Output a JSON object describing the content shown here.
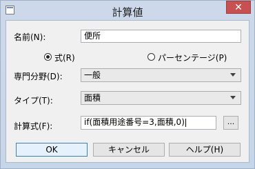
{
  "window": {
    "title": "計算値",
    "close_glyph": "✕"
  },
  "form": {
    "name_label": "名前(N):",
    "name_value": "便所",
    "radio_formula_label": "式(R)",
    "radio_percent_label": "パーセンテージ(P)",
    "category_label": "専門分野(D):",
    "category_value": "一般",
    "type_label": "タイプ(T):",
    "type_value": "面積",
    "formula_label": "計算式(F):",
    "formula_value": "if(面積用途番号=3,面積,0)",
    "browse_label": "..."
  },
  "buttons": {
    "ok": "OK",
    "cancel": "キャンセル",
    "help": "ヘルプ(H)"
  },
  "state": {
    "selected_radio": "formula"
  }
}
